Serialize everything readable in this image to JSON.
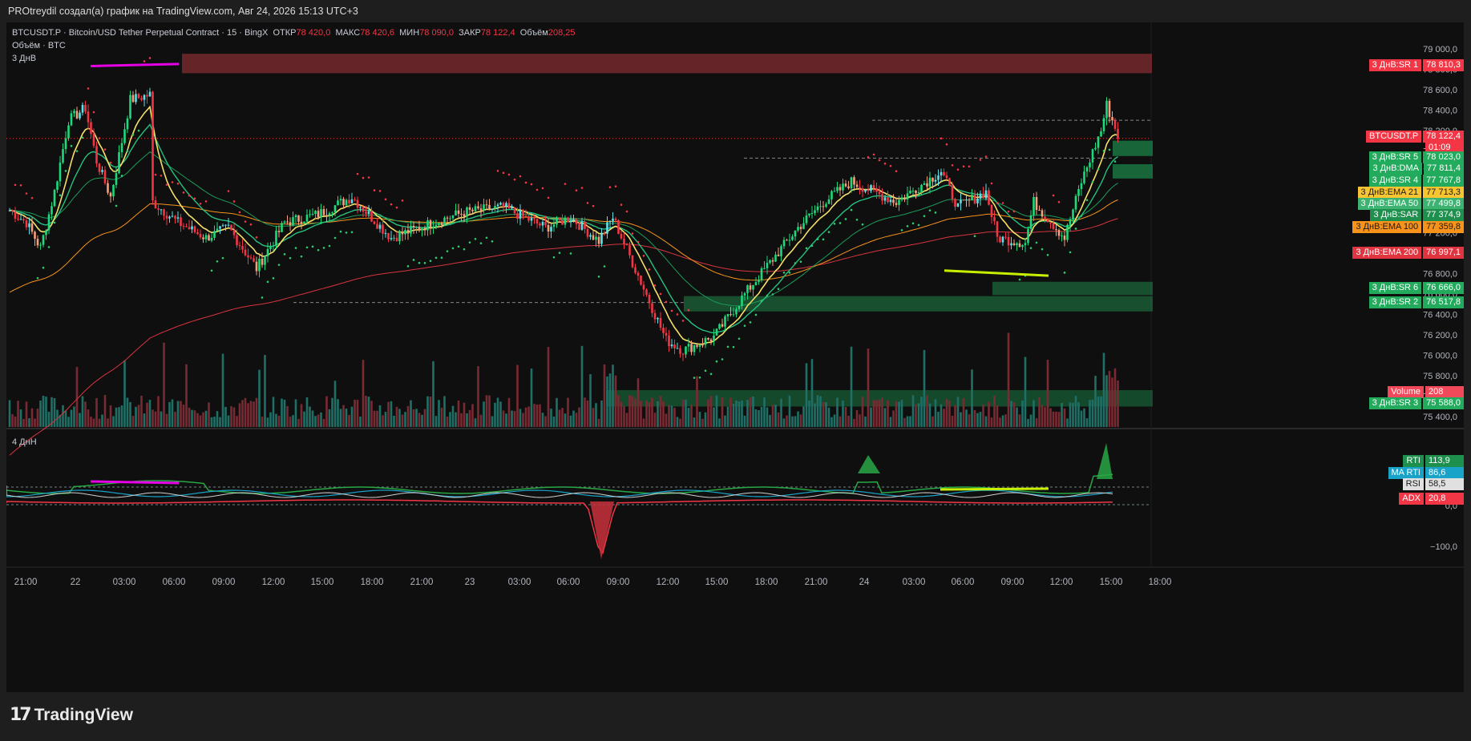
{
  "window": {
    "title": "PROtreydil создал(а) график на TradingView.com, Авг 24, 2026 15:13 UTC+3"
  },
  "legend": {
    "symbol_line": "BTCUSDT.P · Bitcoin/USD Tether Perpetual Contract · 15 · BingX",
    "open_label": "ОТКР",
    "open": "78 420,0",
    "high_label": "МАКС",
    "high": "78 420,6",
    "low_label": "МИН",
    "low": "78 090,0",
    "close_label": "ЗАКР",
    "close": "78 122,4",
    "vol_label": "Объём",
    "vol": "208,25",
    "volume_line": "Объём · BTC",
    "indicator1": "3 ДнВ",
    "indicator2": "4 ДнН"
  },
  "price_axis": [
    "79 000,0",
    "78 800,0",
    "78 600,0",
    "78 400,0",
    "78 200,0",
    "78 000,0",
    "77 800,0",
    "77 600,0",
    "77 400,0",
    "77 200,0",
    "77 000,0",
    "76 800,0",
    "76 600,0",
    "76 400,0",
    "76 200,0",
    "76 000,0",
    "75 800,0",
    "75 600,0",
    "75 400,0"
  ],
  "osc_axis": [
    "0,0",
    "−100,0"
  ],
  "time_axis": [
    "21:00",
    "22",
    "03:00",
    "06:00",
    "09:00",
    "12:00",
    "15:00",
    "18:00",
    "21:00",
    "23",
    "03:00",
    "06:00",
    "09:00",
    "12:00",
    "15:00",
    "18:00",
    "21:00",
    "24",
    "03:00",
    "06:00",
    "09:00",
    "12:00",
    "15:00",
    "18:00"
  ],
  "price_tags": [
    {
      "label": "3 ДнВ:SR 1",
      "value": "78 810,3",
      "color": "#f23645",
      "text": "#ffffff"
    },
    {
      "label": "BTCUSDT.P",
      "value": "78 122,4",
      "color": "#f23645",
      "text": "#ffffff",
      "sub": "01:09"
    },
    {
      "label": "3 ДнВ:SR 5",
      "value": "78 023,0",
      "color": "#22ab5c",
      "text": "#ffffff"
    },
    {
      "label": "3 ДнВ:DMA",
      "value": "77 811,4",
      "color": "#22ab5c",
      "text": "#ffffff"
    },
    {
      "label": "3 ДнВ:SR 4",
      "value": "77 767,8",
      "color": "#22ab5c",
      "text": "#ffffff"
    },
    {
      "label": "3 ДнВ:EMA 21",
      "value": "77 713,3",
      "color": "#f7c531",
      "text": "#1a1a1a"
    },
    {
      "label": "3 ДнВ:EMA 50",
      "value": "77 499,8",
      "color": "#3cb371",
      "text": "#ffffff"
    },
    {
      "label": "3 ДнВ:SAR",
      "value": "77 374,9",
      "color": "#1f8f4d",
      "text": "#ffffff"
    },
    {
      "label": "3 ДнВ:EMA 100",
      "value": "77 359,8",
      "color": "#f7931a",
      "text": "#1a1a1a"
    },
    {
      "label": "3 ДнВ:EMA 200",
      "value": "76 997,1",
      "color": "#e03440",
      "text": "#ffffff"
    },
    {
      "label": "3 ДнВ:SR 6",
      "value": "76 666,0",
      "color": "#22ab5c",
      "text": "#ffffff"
    },
    {
      "label": "3 ДнВ:SR 2",
      "value": "76 517,8",
      "color": "#22ab5c",
      "text": "#ffffff"
    },
    {
      "label": "Volume",
      "value": "208",
      "color": "#f2495a",
      "text": "#ffffff"
    },
    {
      "label": "3 ДнВ:SR 3",
      "value": "75 588,0",
      "color": "#22ab5c",
      "text": "#ffffff"
    }
  ],
  "osc_tags": [
    {
      "label": "RTI",
      "value": "113,9",
      "color": "#1f8f4d",
      "text": "#ffffff"
    },
    {
      "label": "MA RTI",
      "value": "86,6",
      "color": "#1aa3c9",
      "text": "#ffffff"
    },
    {
      "label": "RSI",
      "value": "58,5",
      "color": "#e0e0e0",
      "text": "#1a1a1a"
    },
    {
      "label": "ADX",
      "value": "20,8",
      "color": "#f23645",
      "text": "#ffffff"
    }
  ],
  "logo": {
    "text": "TradingView",
    "mark": "17"
  },
  "colors": {
    "up": "#5ee0e6",
    "down": "#f23645",
    "up2": "#1ed97c",
    "down2": "#f5a07a",
    "ema21": "#f7e06a",
    "ema50": "#26c281",
    "ema100": "#f7931a",
    "ema200": "#d9343f"
  },
  "chart_data": {
    "type": "candlestick",
    "symbol": "BTCUSDT.P",
    "timeframe": "15",
    "ylim": [
      75300,
      79100
    ],
    "last_price": 78122.4,
    "levels": {
      "SR1": 78810.3,
      "SR5": 78023.0,
      "DMA": 77811.4,
      "SR4": 77767.8,
      "EMA21": 77713.3,
      "EMA50": 77499.8,
      "SAR": 77374.9,
      "EMA100": 77359.8,
      "EMA200": 76997.1,
      "SR6": 76666.0,
      "SR2": 76517.8,
      "SR3": 75588.0
    },
    "path": [
      [
        0,
        77420
      ],
      [
        6,
        77300
      ],
      [
        11,
        77050
      ],
      [
        16,
        77600
      ],
      [
        21,
        78300
      ],
      [
        27,
        78420
      ],
      [
        31,
        77900
      ],
      [
        36,
        77550
      ],
      [
        43,
        78500
      ],
      [
        50,
        78550
      ],
      [
        51,
        77500
      ],
      [
        60,
        77300
      ],
      [
        70,
        77150
      ],
      [
        78,
        77250
      ],
      [
        88,
        76850
      ],
      [
        98,
        77300
      ],
      [
        110,
        77380
      ],
      [
        122,
        77550
      ],
      [
        136,
        77150
      ],
      [
        151,
        77300
      ],
      [
        162,
        77400
      ],
      [
        176,
        77450
      ],
      [
        191,
        77250
      ],
      [
        200,
        77350
      ],
      [
        210,
        77120
      ],
      [
        215,
        77350
      ],
      [
        234,
        76150
      ],
      [
        240,
        76050
      ],
      [
        251,
        76180
      ],
      [
        262,
        76600
      ],
      [
        281,
        77250
      ],
      [
        290,
        77500
      ],
      [
        300,
        77700
      ],
      [
        316,
        77500
      ],
      [
        332,
        77800
      ],
      [
        338,
        77450
      ],
      [
        348,
        77600
      ],
      [
        352,
        77150
      ],
      [
        362,
        77100
      ],
      [
        365,
        77500
      ],
      [
        376,
        77150
      ],
      [
        382,
        77700
      ],
      [
        389,
        78200
      ],
      [
        391,
        78450
      ],
      [
        395,
        78150
      ]
    ]
  }
}
